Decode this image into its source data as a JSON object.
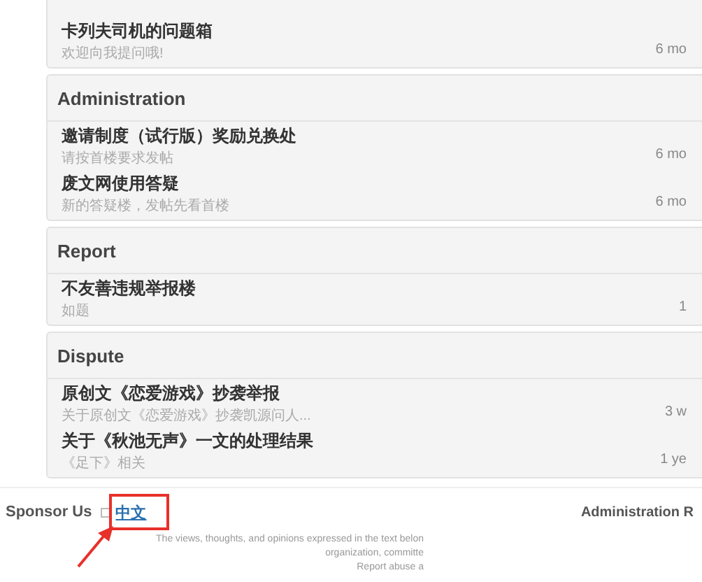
{
  "sections": [
    {
      "rows": [
        {
          "title": "卡列夫司机的问题箱",
          "description": "欢迎向我提问哦!",
          "time": "6 mo"
        }
      ]
    },
    {
      "title": "Administration",
      "rows": [
        {
          "title": "邀请制度（试行版）奖励兑换处",
          "description": "请按首楼要求发帖",
          "time": "6 mo"
        },
        {
          "title": "废文网使用答疑",
          "description": "新的答疑楼，发帖先看首楼",
          "time": "6 mo"
        }
      ]
    },
    {
      "title": "Report",
      "rows": [
        {
          "title": "不友善违规举报楼",
          "description": "如题",
          "time": "1"
        }
      ]
    },
    {
      "title": "Dispute",
      "rows": [
        {
          "title": "原创文《恋爱游戏》抄袭举报",
          "description": "关于原创文《恋爱游戏》抄袭凯源问人...",
          "time": "3 w"
        },
        {
          "title": "关于《秋池无声》一文的处理结果",
          "description": "《足下》相关",
          "time": "1 ye"
        }
      ]
    }
  ],
  "footer": {
    "sponsor": "Sponsor Us",
    "language": "中文",
    "admin": "Administration R",
    "notes": [
      "The views, thoughts, and opinions expressed in the text belon",
      "organization, committe",
      "Report abuse a"
    ]
  }
}
